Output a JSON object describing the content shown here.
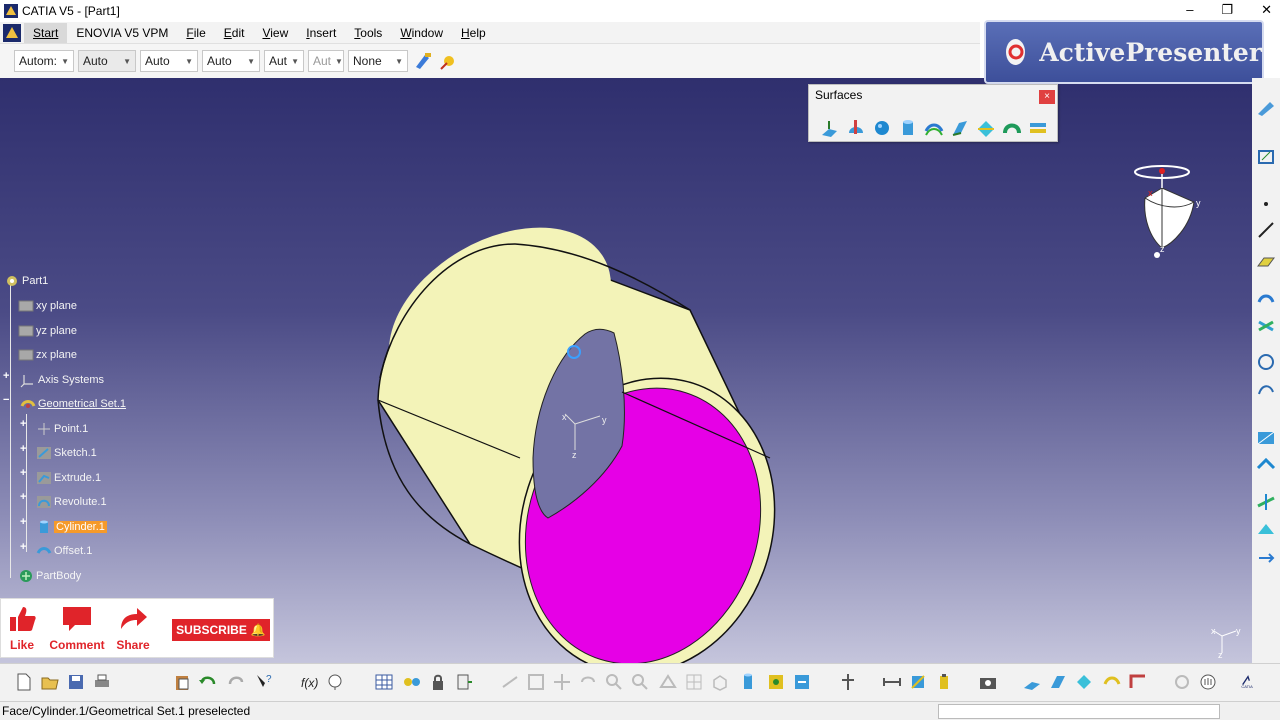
{
  "window": {
    "title": "CATIA V5 - [Part1]",
    "controls": {
      "minimize": "–",
      "maximize": "❐",
      "close": "✕"
    }
  },
  "menubar": {
    "items": [
      "Start",
      "ENOVIA V5 VPM",
      "File",
      "Edit",
      "View",
      "Insert",
      "Tools",
      "Window",
      "Help"
    ]
  },
  "toolbar": {
    "combos": [
      "Autom:",
      "Auto",
      "Auto",
      "Auto",
      "Aut",
      "Aut",
      "None"
    ]
  },
  "watermark": {
    "text": "ActivePresenter"
  },
  "surfaces_toolbar": {
    "title": "Surfaces",
    "close": "×",
    "icons": [
      "extrude-icon",
      "revolve-icon",
      "sphere-icon",
      "cylinder-icon",
      "offset-icon",
      "sweep-icon",
      "fill-icon",
      "multi-section-icon",
      "blend-icon"
    ]
  },
  "tree": {
    "root": "Part1",
    "nodes": {
      "xy": "xy plane",
      "yz": "yz plane",
      "zx": "zx plane",
      "axis": "Axis Systems",
      "geoset": "Geometrical Set.1",
      "point": "Point.1",
      "sketch": "Sketch.1",
      "extrude": "Extrude.1",
      "revolute": "Revolute.1",
      "cylinder": "Cylinder.1",
      "offset": "Offset.1",
      "partbody": "PartBody"
    }
  },
  "social": {
    "like": "Like",
    "comment": "Comment",
    "share": "Share",
    "subscribe": "SUBSCRIBE"
  },
  "compass": {
    "x": "x",
    "y": "y",
    "z": "z"
  },
  "axis_triad": {
    "x": "x",
    "y": "y",
    "z": "z"
  },
  "status": {
    "text": "Face/Cylinder.1/Geometrical Set.1 preselected"
  },
  "colors": {
    "viewport_top": "#2f2f6e",
    "viewport_bottom": "#c5c5dc",
    "cylinder_outer": "#f3f3b8",
    "cylinder_inner": "#e600e6",
    "selected_node": "#f59a2a",
    "youtube_red": "#e0242a"
  }
}
